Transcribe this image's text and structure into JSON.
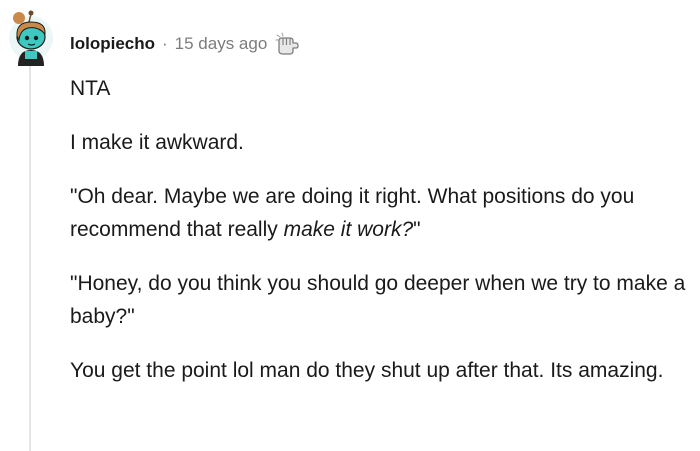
{
  "comment": {
    "username": "lolopiecho",
    "separator": "·",
    "time_ago": "15 days ago",
    "award_icon": "helpful-hand-award-icon",
    "avatar_icon": "snoo-avatar-icon",
    "paragraphs": [
      {
        "text": "NTA"
      },
      {
        "text": "I make it awkward."
      },
      {
        "text_before": "\"Oh dear. Maybe we are doing it right. What positions do you recommend that really ",
        "emphasis": "make it work?",
        "text_after": "\""
      },
      {
        "text": "\"Honey, do you think you should go deeper when we try to make a baby?\""
      },
      {
        "text": "You get the point lol man do they shut up after that. Its amazing."
      }
    ]
  },
  "colors": {
    "username": "#1a1a1b",
    "meta": "#7c7c7c",
    "body_text": "#1a1a1b",
    "thread_line": "#e5e5e5",
    "avatar_skin": "#3ec9c0",
    "avatar_hair": "#c8894a"
  }
}
